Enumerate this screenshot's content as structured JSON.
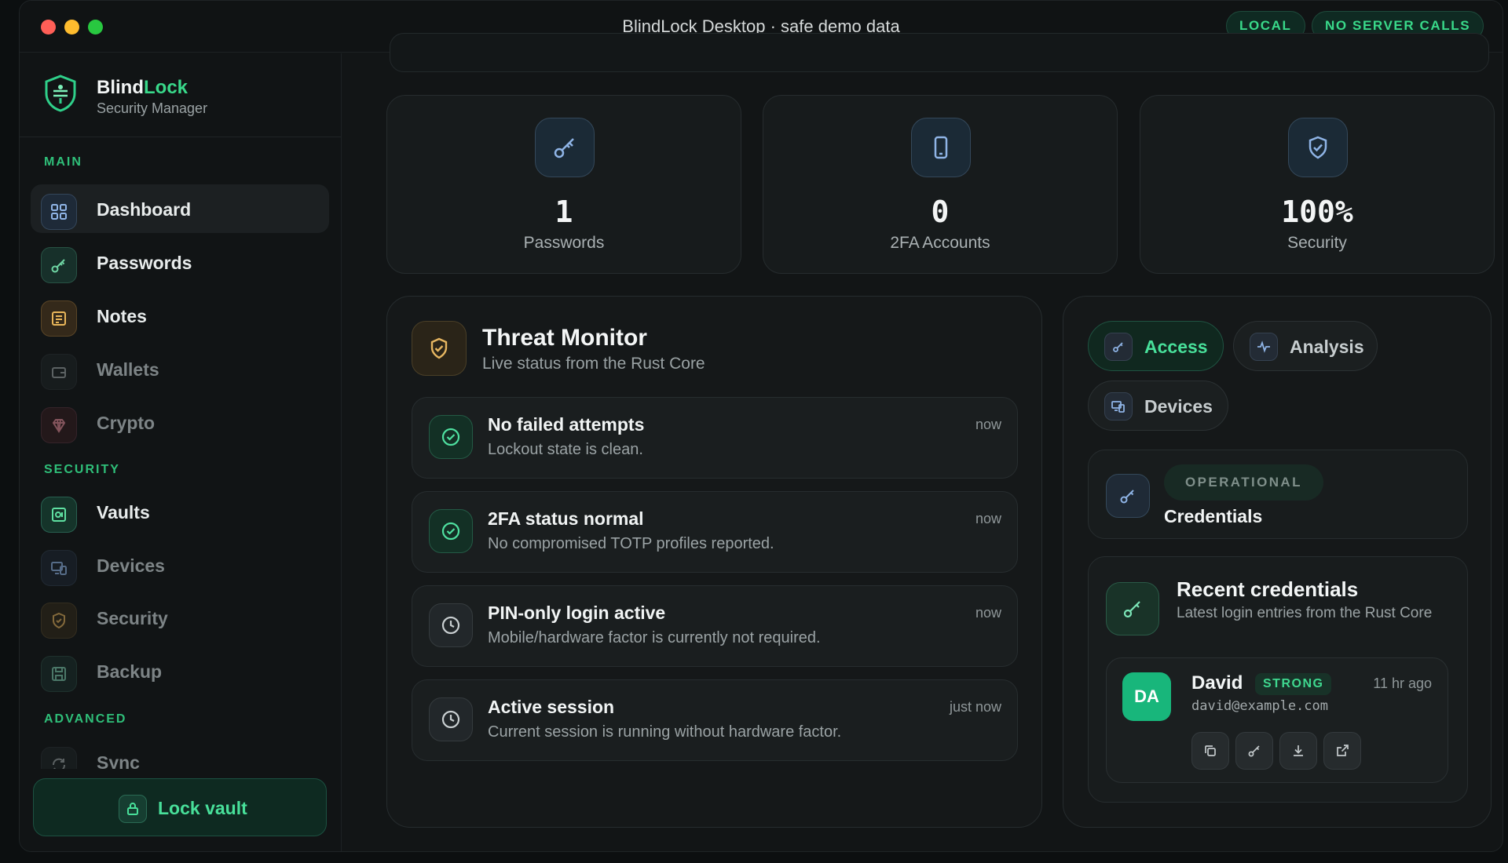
{
  "window": {
    "title": "BlindLock Desktop · safe demo data",
    "badges": [
      "LOCAL",
      "NO SERVER CALLS"
    ]
  },
  "brand": {
    "name_part1": "Blind",
    "name_part2": "Lock",
    "subtitle": "Security Manager"
  },
  "sidebar": {
    "sections": {
      "main": "MAIN",
      "security": "SECURITY",
      "advanced": "ADVANCED"
    },
    "items": [
      {
        "label": "Dashboard",
        "icon": "grid-icon",
        "active": true
      },
      {
        "label": "Passwords",
        "icon": "key-icon"
      },
      {
        "label": "Notes",
        "icon": "note-icon"
      },
      {
        "label": "Wallets",
        "icon": "wallet-icon"
      },
      {
        "label": "Crypto",
        "icon": "diamond-icon"
      },
      {
        "label": "Vaults",
        "icon": "vault-icon"
      },
      {
        "label": "Devices",
        "icon": "devices-icon"
      },
      {
        "label": "Security",
        "icon": "shield-icon"
      },
      {
        "label": "Backup",
        "icon": "save-icon"
      },
      {
        "label": "Sync",
        "icon": "sync-icon"
      }
    ],
    "lock_button": "Lock vault"
  },
  "stats": [
    {
      "value": "1",
      "label": "Passwords",
      "icon": "key-icon"
    },
    {
      "value": "0",
      "label": "2FA Accounts",
      "icon": "phone-icon"
    },
    {
      "value": "100%",
      "label": "Security",
      "icon": "shield-check-icon"
    }
  ],
  "threat_monitor": {
    "title": "Threat Monitor",
    "subtitle": "Live status from the Rust Core",
    "items": [
      {
        "title": "No failed attempts",
        "desc": "Lockout state is clean.",
        "time": "now",
        "status": "ok"
      },
      {
        "title": "2FA status normal",
        "desc": "No compromised TOTP profiles reported.",
        "time": "now",
        "status": "ok"
      },
      {
        "title": "PIN-only login active",
        "desc": "Mobile/hardware factor is currently not required.",
        "time": "now",
        "status": "clock"
      },
      {
        "title": "Active session",
        "desc": "Current session is running without hardware factor.",
        "time": "just now",
        "status": "clock"
      }
    ]
  },
  "right_panel": {
    "tabs": [
      {
        "label": "Access",
        "active": true
      },
      {
        "label": "Analysis"
      },
      {
        "label": "Devices"
      }
    ],
    "status_card": {
      "badge": "OPERATIONAL",
      "label": "Credentials"
    },
    "recent": {
      "title": "Recent credentials",
      "subtitle": "Latest login entries from the Rust Core",
      "entry": {
        "initials": "DA",
        "name": "David",
        "strength": "STRONG",
        "time": "11 hr ago",
        "email": "david@example.com"
      }
    }
  },
  "colors": {
    "accent": "#39d98a",
    "background": "#121516",
    "card": "#171b1c"
  }
}
